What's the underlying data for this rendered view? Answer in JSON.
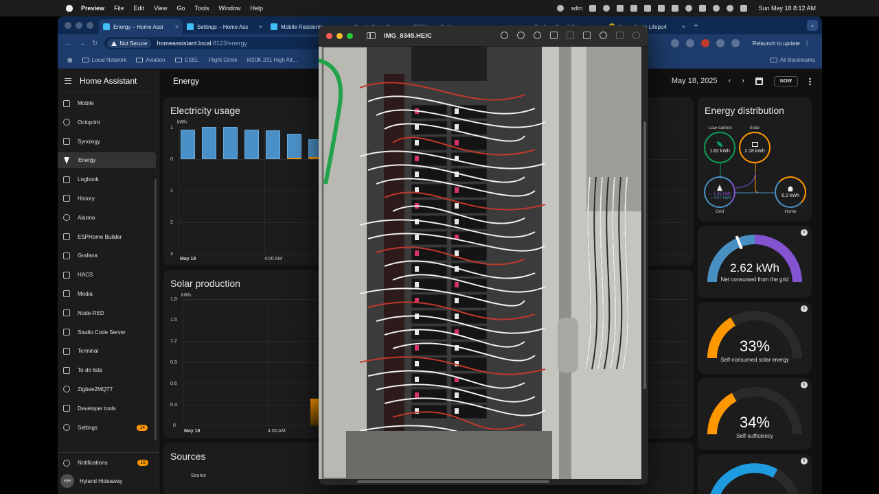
{
  "menubar": {
    "app_name": "Preview",
    "items": [
      "File",
      "Edit",
      "View",
      "Go",
      "Tools",
      "Window",
      "Help"
    ],
    "tray_text": "sdm",
    "clock": "Sun May 18  8:12 AM"
  },
  "browser": {
    "tabs": [
      {
        "title": "Energy – Home Assi",
        "active": true
      },
      {
        "title": "Settings – Home Ass",
        "active": false
      },
      {
        "title": "Mobile Residentia",
        "active": false
      },
      {
        "title": "Studio Code S",
        "active": false
      },
      {
        "title": "ESPHome Build",
        "active": false
      },
      {
        "title": "",
        "active": false
      },
      {
        "title": "Ecoflow Gen 3 P",
        "active": false
      },
      {
        "title": "Deep Cycle Lifepo4",
        "active": false
      }
    ],
    "security_label": "Not Secure",
    "url_host": "homeassistant.local",
    "url_path": ":8123/energy",
    "relaunch_label": "Relaunch to update",
    "bookmarks": [
      "Local Network",
      "Aviation",
      "CSEL",
      "Flight Circle",
      "M20K 231 High Alt..."
    ],
    "all_bookmarks": "All Bookmarks"
  },
  "ha": {
    "app_title": "Home Assistant",
    "page_title": "Energy",
    "date": "May 18, 2025",
    "now_label": "NOW",
    "sidebar": [
      {
        "label": "Mobile",
        "icon": "phone-icon"
      },
      {
        "label": "Octoprint",
        "icon": "printer-3d-icon"
      },
      {
        "label": "Synology",
        "icon": "nas-icon"
      },
      {
        "label": "Energy",
        "icon": "lightning-bolt-icon",
        "active": true
      },
      {
        "label": "Logbook",
        "icon": "list-icon"
      },
      {
        "label": "History",
        "icon": "chart-bar-icon"
      },
      {
        "label": "Alarmo",
        "icon": "shield-icon"
      },
      {
        "label": "ESPHome Builder",
        "icon": "esphome-icon"
      },
      {
        "label": "Grafana",
        "icon": "grafana-icon"
      },
      {
        "label": "HACS",
        "icon": "store-icon"
      },
      {
        "label": "Media",
        "icon": "play-box-icon"
      },
      {
        "label": "Node-RED",
        "icon": "sitemap-icon"
      },
      {
        "label": "Studio Code Server",
        "icon": "vscode-icon"
      },
      {
        "label": "Terminal",
        "icon": "console-icon"
      },
      {
        "label": "To-do lists",
        "icon": "checkbox-list-icon"
      },
      {
        "label": "Zigbee2MQTT",
        "icon": "zigbee-icon"
      },
      {
        "label": "Developer tools",
        "icon": "hammer-icon"
      },
      {
        "label": "Settings",
        "icon": "cog-icon",
        "badge": "14"
      }
    ],
    "notifications": {
      "label": "Notifications",
      "badge": "16"
    },
    "user": {
      "initials": "HH",
      "name": "Hyland Hideaway"
    },
    "electricity": {
      "title": "Electricity usage",
      "unit": "kWh",
      "y_ticks": [
        "1",
        "0",
        "1",
        "2",
        "3"
      ],
      "x_date": "May 18",
      "x_time": "4:00 AM"
    },
    "solar": {
      "title": "Solar production",
      "unit": "kWh",
      "y_ticks": [
        "1.8",
        "1.5",
        "1.2",
        "0.9",
        "0.6",
        "0.3",
        "0"
      ],
      "x_date": "May 18",
      "x_time": "4:00 AM"
    },
    "sources": {
      "title": "Sources",
      "column": "Source"
    },
    "distribution": {
      "title": "Energy distribution",
      "low_carbon_label": "Low-carbon",
      "low_carbon_value": "1.82 kWh",
      "solar_label": "Solar",
      "solar_value": "2.18 kWh",
      "grid_label": "Grid",
      "grid_out": "← 1.45 kWh",
      "grid_in": "→ 4.07 kWh",
      "home_label": "Home",
      "home_value": "6.2 kWh",
      "colors": {
        "low_carbon": "#0f9d58",
        "solar": "#ff9800",
        "grid": "#488fc2",
        "grid_return": "#8353d1",
        "home": "#488fc2"
      }
    },
    "gauges": [
      {
        "value": "2.62 kWh",
        "label": "Net consumed from the grid",
        "level": 0.38
      },
      {
        "value": "33%",
        "label": "Self-consumed solar energy",
        "level": 0.33
      },
      {
        "value": "34%",
        "label": "Self-sufficiency",
        "level": 0.34
      }
    ]
  },
  "preview": {
    "filename": "IMG_8345.HEIC"
  }
}
